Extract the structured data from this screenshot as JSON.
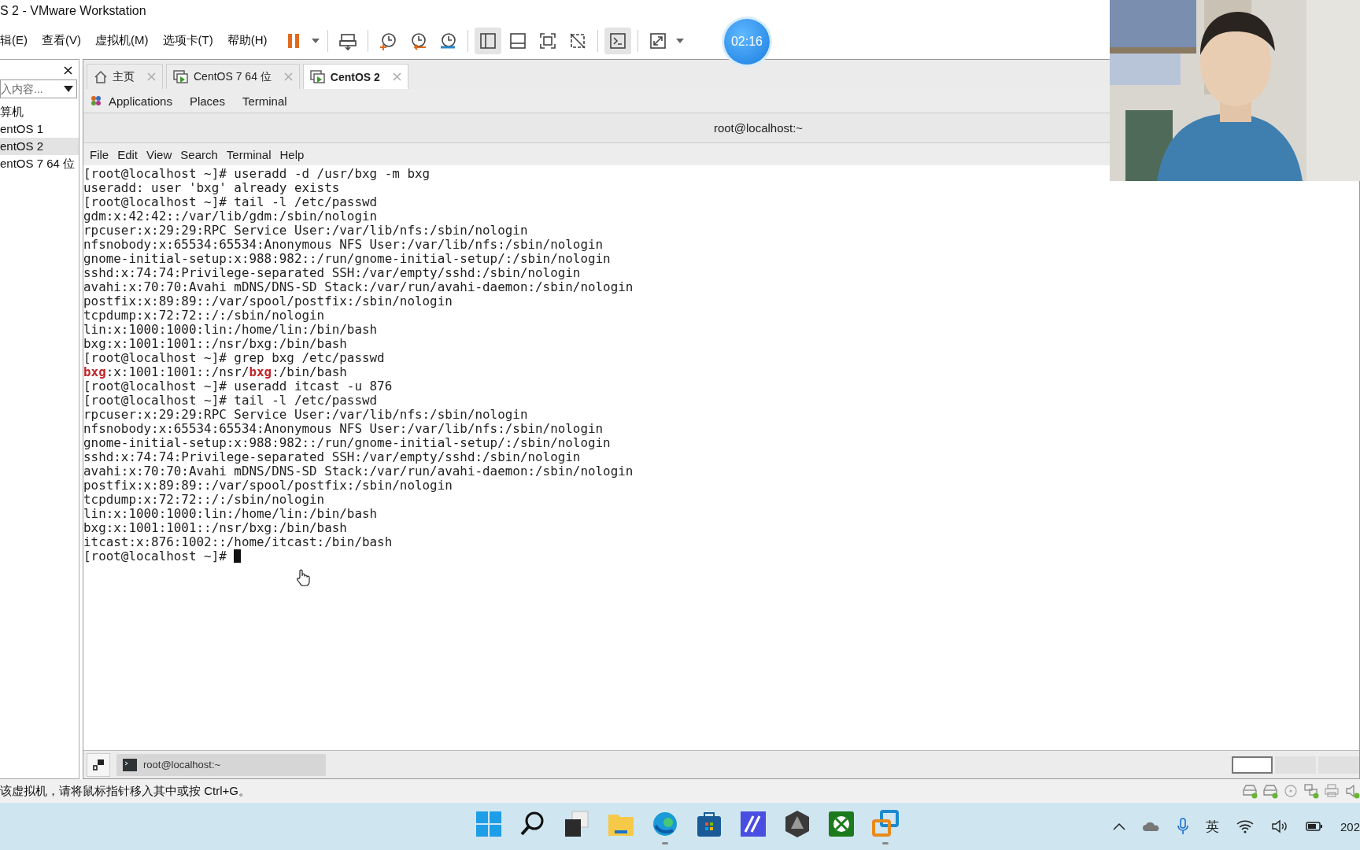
{
  "window": {
    "title": "S 2 - VMware Workstation"
  },
  "menu": [
    "辑(E)",
    "查看(V)",
    "虚拟机(M)",
    "选项卡(T)",
    "帮助(H)"
  ],
  "toolbar": [
    [
      {
        "kind": "pause",
        "selected": false,
        "dropdown": true
      }
    ],
    [
      {
        "kind": "sendkeys",
        "selected": false,
        "dropdown": false
      }
    ],
    [
      {
        "kind": "snapshot",
        "selected": false,
        "dropdown": false
      },
      {
        "kind": "revert",
        "selected": false,
        "dropdown": false
      },
      {
        "kind": "manager",
        "selected": false,
        "dropdown": false
      }
    ],
    [
      {
        "kind": "library",
        "selected": true,
        "dropdown": false
      },
      {
        "kind": "thumbs",
        "selected": false,
        "dropdown": false
      },
      {
        "kind": "fullscreen",
        "selected": false,
        "dropdown": false
      },
      {
        "kind": "unity",
        "selected": false,
        "dropdown": false
      }
    ],
    [
      {
        "kind": "console",
        "selected": true,
        "dropdown": false
      }
    ],
    [
      {
        "kind": "stretch",
        "selected": false,
        "dropdown": true
      }
    ]
  ],
  "timer": "02:16",
  "webcam": {
    "kind": "picture"
  },
  "sidebar": {
    "search": {
      "placeholder": "入内容..."
    },
    "items": [
      {
        "label": "算机",
        "selected": false,
        "children": [
          {
            "label": "entOS 1",
            "selected": false
          },
          {
            "label": "entOS 2",
            "selected": true
          },
          {
            "label": "entOS 7 64 位",
            "selected": false
          }
        ]
      }
    ]
  },
  "tabs": [
    {
      "label": "主页",
      "kind": "home",
      "selected": false
    },
    {
      "label": "CentOS 7 64 位",
      "kind": "vm",
      "selected": false
    },
    {
      "label": "CentOS 2",
      "kind": "vm",
      "selected": true
    }
  ],
  "gnome_bar": [
    "Applications",
    "Places",
    "Terminal"
  ],
  "terminal": {
    "title": "root@localhost:~",
    "menu": [
      "File",
      "Edit",
      "View",
      "Search",
      "Terminal",
      "Help"
    ],
    "lines": [
      {
        "parts": [
          {
            "text": "[root@localhost ~]# useradd -d /usr/bxg -m bxg",
            "match": false
          }
        ]
      },
      {
        "parts": [
          {
            "text": "useradd: user 'bxg' already exists",
            "match": false
          }
        ]
      },
      {
        "parts": [
          {
            "text": "[root@localhost ~]# tail -l /etc/passwd",
            "match": false
          }
        ]
      },
      {
        "parts": [
          {
            "text": "gdm:x:42:42::/var/lib/gdm:/sbin/nologin",
            "match": false
          }
        ]
      },
      {
        "parts": [
          {
            "text": "rpcuser:x:29:29:RPC Service User:/var/lib/nfs:/sbin/nologin",
            "match": false
          }
        ]
      },
      {
        "parts": [
          {
            "text": "nfsnobody:x:65534:65534:Anonymous NFS User:/var/lib/nfs:/sbin/nologin",
            "match": false
          }
        ]
      },
      {
        "parts": [
          {
            "text": "gnome-initial-setup:x:988:982::/run/gnome-initial-setup/:/sbin/nologin",
            "match": false
          }
        ]
      },
      {
        "parts": [
          {
            "text": "sshd:x:74:74:Privilege-separated SSH:/var/empty/sshd:/sbin/nologin",
            "match": false
          }
        ]
      },
      {
        "parts": [
          {
            "text": "avahi:x:70:70:Avahi mDNS/DNS-SD Stack:/var/run/avahi-daemon:/sbin/nologin",
            "match": false
          }
        ]
      },
      {
        "parts": [
          {
            "text": "postfix:x:89:89::/var/spool/postfix:/sbin/nologin",
            "match": false
          }
        ]
      },
      {
        "parts": [
          {
            "text": "tcpdump:x:72:72::/:/sbin/nologin",
            "match": false
          }
        ]
      },
      {
        "parts": [
          {
            "text": "lin:x:1000:1000:lin:/home/lin:/bin/bash",
            "match": false
          }
        ]
      },
      {
        "parts": [
          {
            "text": "bxg:x:1001:1001::/nsr/bxg:/bin/bash",
            "match": false
          }
        ]
      },
      {
        "parts": [
          {
            "text": "[root@localhost ~]# grep bxg /etc/passwd",
            "match": false
          }
        ]
      },
      {
        "parts": [
          {
            "text": "bxg",
            "match": true
          },
          {
            "text": ":x:1001:1001::/nsr/",
            "match": false
          },
          {
            "text": "bxg",
            "match": true
          },
          {
            "text": ":/bin/bash",
            "match": false
          }
        ]
      },
      {
        "parts": [
          {
            "text": "[root@localhost ~]# useradd itcast -u 876",
            "match": false
          }
        ]
      },
      {
        "parts": [
          {
            "text": "[root@localhost ~]# tail -l /etc/passwd",
            "match": false
          }
        ]
      },
      {
        "parts": [
          {
            "text": "rpcuser:x:29:29:RPC Service User:/var/lib/nfs:/sbin/nologin",
            "match": false
          }
        ]
      },
      {
        "parts": [
          {
            "text": "nfsnobody:x:65534:65534:Anonymous NFS User:/var/lib/nfs:/sbin/nologin",
            "match": false
          }
        ]
      },
      {
        "parts": [
          {
            "text": "gnome-initial-setup:x:988:982::/run/gnome-initial-setup/:/sbin/nologin",
            "match": false
          }
        ]
      },
      {
        "parts": [
          {
            "text": "sshd:x:74:74:Privilege-separated SSH:/var/empty/sshd:/sbin/nologin",
            "match": false
          }
        ]
      },
      {
        "parts": [
          {
            "text": "avahi:x:70:70:Avahi mDNS/DNS-SD Stack:/var/run/avahi-daemon:/sbin/nologin",
            "match": false
          }
        ]
      },
      {
        "parts": [
          {
            "text": "postfix:x:89:89::/var/spool/postfix:/sbin/nologin",
            "match": false
          }
        ]
      },
      {
        "parts": [
          {
            "text": "tcpdump:x:72:72::/:/sbin/nologin",
            "match": false
          }
        ]
      },
      {
        "parts": [
          {
            "text": "lin:x:1000:1000:lin:/home/lin:/bin/bash",
            "match": false
          }
        ]
      },
      {
        "parts": [
          {
            "text": "bxg:x:1001:1001::/nsr/bxg:/bin/bash",
            "match": false
          }
        ]
      },
      {
        "parts": [
          {
            "text": "itcast:x:876:1002::/home/itcast:/bin/bash",
            "match": false
          }
        ]
      }
    ],
    "prompt": {
      "text": "[root@localhost ~]#",
      "cursor": true
    }
  },
  "bottom_panel": {
    "task": "root@localhost:~",
    "workspaces": [
      {
        "selected": true
      },
      {
        "selected": false
      },
      {
        "selected": false
      }
    ]
  },
  "status_bar": {
    "text": "该虚拟机，请将鼠标指针移入其中或按 Ctrl+G。",
    "devices": [
      {
        "kind": "disk",
        "connected": true
      },
      {
        "kind": "disk",
        "connected": true
      },
      {
        "kind": "cd",
        "connected": false
      },
      {
        "kind": "network",
        "connected": true
      },
      {
        "kind": "printer",
        "connected": false
      },
      {
        "kind": "sound",
        "connected": true
      }
    ]
  },
  "taskbar": {
    "apps": [
      {
        "kind": "start",
        "running": false
      },
      {
        "kind": "search",
        "running": false
      },
      {
        "kind": "taskview",
        "running": false
      },
      {
        "kind": "files",
        "running": false
      },
      {
        "kind": "edge",
        "running": true
      },
      {
        "kind": "store",
        "running": false
      },
      {
        "kind": "ai",
        "running": false
      },
      {
        "kind": "hex",
        "running": false
      },
      {
        "kind": "xbox",
        "running": false
      },
      {
        "kind": "vmware",
        "running": true
      }
    ],
    "tray": {
      "ime": "英",
      "clock": "202"
    }
  }
}
